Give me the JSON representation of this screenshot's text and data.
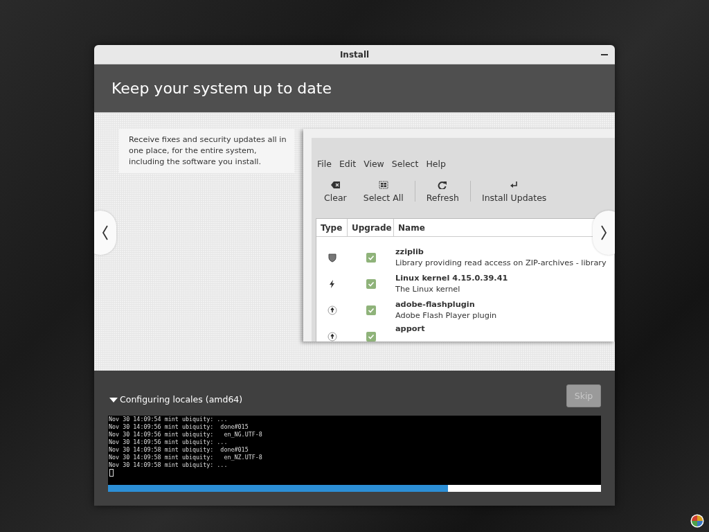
{
  "window": {
    "title": "Install"
  },
  "header": {
    "title": "Keep your system up to date"
  },
  "slide": {
    "text": "Receive fixes and security updates all in one place, for the entire system, including the software you install.",
    "screenshot": {
      "menu": [
        "File",
        "Edit",
        "View",
        "Select",
        "Help"
      ],
      "toolbar": [
        {
          "kind": "clear",
          "label": "Clear"
        },
        {
          "kind": "select-all",
          "label": "Select All"
        },
        {
          "kind": "refresh",
          "label": "Refresh"
        },
        {
          "kind": "install",
          "label": "Install Updates"
        }
      ],
      "columns": [
        "Type",
        "Upgrade",
        "Name"
      ],
      "rows": [
        {
          "kind": "security",
          "checked": true,
          "name": "zziplib",
          "description": "Library providing read access on ZIP-archives - library"
        },
        {
          "kind": "kernel",
          "checked": true,
          "name": "Linux kernel 4.15.0.39.41",
          "description": "The Linux kernel"
        },
        {
          "kind": "package",
          "checked": true,
          "name": "adobe-flashplugin",
          "description": "Adobe Flash Player plugin"
        },
        {
          "kind": "package",
          "checked": true,
          "name": "apport"
        }
      ]
    }
  },
  "progress": {
    "expanded": true,
    "label": "Configuring locales (amd64)",
    "skip": {
      "label": "Skip",
      "disabled": true
    },
    "log": [
      "Nov 30 14:09:54 mint ubiquity: ...",
      "Nov 30 14:09:56 mint ubiquity:  done#015",
      "Nov 30 14:09:56 mint ubiquity:   en_NG.UTF-8",
      "Nov 30 14:09:56 mint ubiquity: ...",
      "Nov 30 14:09:58 mint ubiquity:  done#015",
      "Nov 30 14:09:58 mint ubiquity:   en_NZ.UTF-8",
      "Nov 30 14:09:58 mint ubiquity: ..."
    ],
    "level": 0.69
  }
}
